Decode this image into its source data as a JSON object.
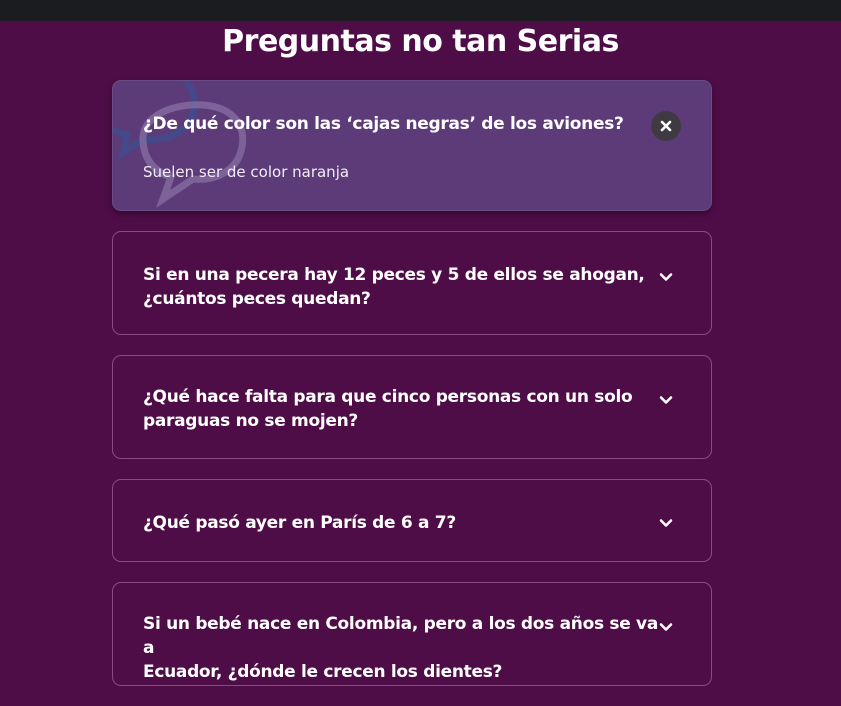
{
  "page": {
    "title": "Preguntas no tan Serias"
  },
  "colors": {
    "background": "#4f0d48",
    "active_card": "#5c3b78",
    "card_border": "#8a4b84",
    "topbar": "#1a1c1f"
  },
  "faqs": [
    {
      "question": "¿De qué color son las ‘cajas negras’ de los aviones?",
      "answer": "Suelen ser de color naranja",
      "expanded": true,
      "toggle_icon": "close-icon"
    },
    {
      "question_line1": "Si en una pecera hay 12 peces y 5 de ellos se ahogan,",
      "question_line2": "¿cuántos peces quedan?",
      "expanded": false,
      "toggle_icon": "chevron-down-icon"
    },
    {
      "question_line1": "¿Qué hace falta para que cinco personas con un solo",
      "question_line2": "paraguas no se mojen?",
      "expanded": false,
      "toggle_icon": "chevron-down-icon"
    },
    {
      "question": "¿Qué pasó ayer en París de 6 a 7?",
      "expanded": false,
      "toggle_icon": "chevron-down-icon"
    },
    {
      "question_line1": "Si un bebé nace en Colombia, pero a los dos años se va a",
      "question_line2": "Ecuador, ¿dónde le crecen los dientes?",
      "expanded": false,
      "toggle_icon": "chevron-down-icon"
    }
  ]
}
